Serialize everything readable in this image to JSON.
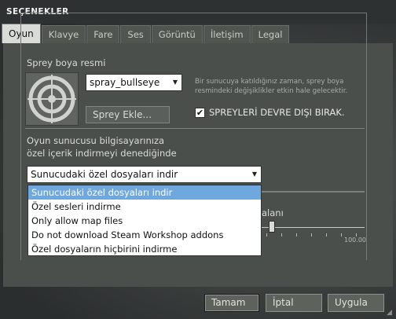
{
  "window": {
    "title": "SEÇENEKLER"
  },
  "tabs": [
    {
      "label": "Oyun",
      "active": true
    },
    {
      "label": "Klavye",
      "active": false
    },
    {
      "label": "Fare",
      "active": false
    },
    {
      "label": "Ses",
      "active": false
    },
    {
      "label": "Görüntü",
      "active": false
    },
    {
      "label": "İletişim",
      "active": false
    },
    {
      "label": "Legal",
      "active": false
    }
  ],
  "spray": {
    "section_label": "Sprey boya resmi",
    "selected": "spray_bullseye",
    "add_button": "Sprey Ekle...",
    "hint": "Bir sunucuya katıldığınız zaman, sprey boya resmindeki değişiklikler etkin hale gelecektir.",
    "disable_checkbox": {
      "label": "SPREYLERİ DEVRE DIŞI BIRAK.",
      "checked": true
    },
    "icon": "bullseye-target-icon"
  },
  "download": {
    "label_line1": "Oyun sunucusu bilgisayarınıza",
    "label_line2": "özel içerik indirmeyi denediğinde",
    "selected": "Sunucudaki özel dosyaları indir",
    "options": [
      "Sunucudaki özel dosyaları indir",
      "Özel sesleri indirme",
      "Only allow map files",
      "Do not download Steam Workshop addons",
      "Özel dosyaların hiçbirini indirme"
    ],
    "selected_index": 0
  },
  "slider": {
    "partial_label": "alanı",
    "max_label": "100.00",
    "value_fraction": 0.1
  },
  "buttons": {
    "ok": "Tamam",
    "cancel": "İptal",
    "apply": "Uygula"
  },
  "colors": {
    "highlight": "#6fa7df",
    "panel": "#4b4f4c",
    "active_tab": "#d8dbd6"
  }
}
